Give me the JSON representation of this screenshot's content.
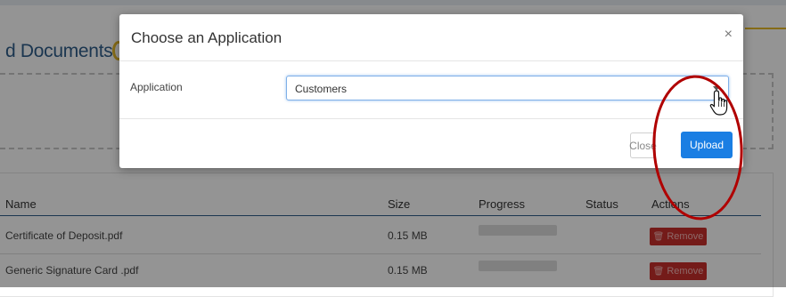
{
  "background": {
    "heading": "d Documents",
    "table": {
      "headers": [
        "Name",
        "Size",
        "Progress",
        "Status",
        "Actions"
      ],
      "rows": [
        {
          "name": "Certificate of Deposit.pdf",
          "size": "0.15 MB",
          "action": "Remove"
        },
        {
          "name": "Generic Signature Card .pdf",
          "size": "0.15 MB",
          "action": "Remove"
        }
      ]
    }
  },
  "modal": {
    "title": "Choose an Application",
    "close_symbol": "×",
    "field_label": "Application",
    "select": {
      "value": "Customers"
    },
    "buttons": {
      "close": "Close",
      "upload": "Upload"
    }
  },
  "icons": {
    "modal_close": "close-icon",
    "select_arrow": "chevron-down-icon",
    "remove": "trash-icon",
    "cursor": "hand-pointer-icon"
  },
  "colors": {
    "primary": "#1a7ee3",
    "danger": "#c9302c",
    "heading": "#2f5d8a",
    "accent": "#e6b928",
    "annotation": "#b00000"
  }
}
